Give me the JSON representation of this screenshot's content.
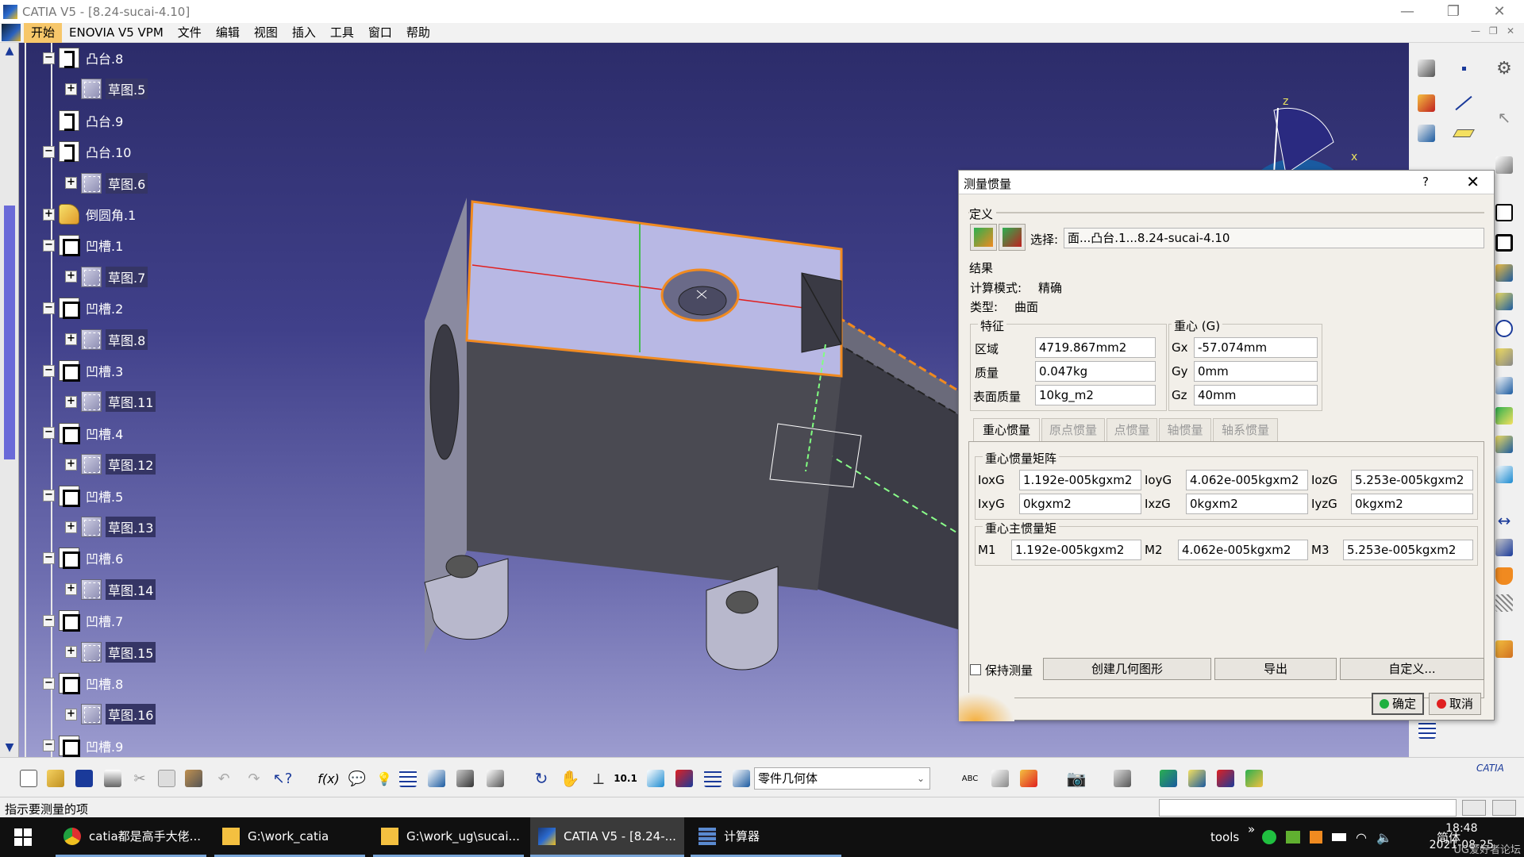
{
  "window": {
    "title": "CATIA V5 - [8.24-sucai-4.10]",
    "min": "—",
    "restore": "❐",
    "close": "✕"
  },
  "menu": {
    "items": [
      "开始",
      "ENOVIA V5 VPM",
      "文件",
      "编辑",
      "视图",
      "插入",
      "工具",
      "窗口",
      "帮助"
    ],
    "doc_controls": [
      "—",
      "❐",
      "✕"
    ]
  },
  "tree": {
    "nodes": [
      {
        "label": "凸台.8",
        "type": "pad",
        "toggle": "−"
      },
      {
        "label": "草图.5",
        "type": "sketch",
        "toggle": "+"
      },
      {
        "label": "凸台.9",
        "type": "pad",
        "toggle": ""
      },
      {
        "label": "凸台.10",
        "type": "pad",
        "toggle": "−"
      },
      {
        "label": "草图.6",
        "type": "sketch",
        "toggle": "+"
      },
      {
        "label": "倒圆角.1",
        "type": "fillet",
        "toggle": "+"
      },
      {
        "label": "凹槽.1",
        "type": "pocket",
        "toggle": "−"
      },
      {
        "label": "草图.7",
        "type": "sketch",
        "toggle": "+"
      },
      {
        "label": "凹槽.2",
        "type": "pocket",
        "toggle": "−"
      },
      {
        "label": "草图.8",
        "type": "sketch",
        "toggle": "+"
      },
      {
        "label": "凹槽.3",
        "type": "pocket",
        "toggle": "−"
      },
      {
        "label": "草图.11",
        "type": "sketch",
        "toggle": "+"
      },
      {
        "label": "凹槽.4",
        "type": "pocket",
        "toggle": "−"
      },
      {
        "label": "草图.12",
        "type": "sketch",
        "toggle": "+"
      },
      {
        "label": "凹槽.5",
        "type": "pocket",
        "toggle": "−"
      },
      {
        "label": "草图.13",
        "type": "sketch",
        "toggle": "+"
      },
      {
        "label": "凹槽.6",
        "type": "pocket",
        "toggle": "−"
      },
      {
        "label": "草图.14",
        "type": "sketch",
        "toggle": "+"
      },
      {
        "label": "凹槽.7",
        "type": "pocket",
        "toggle": "−"
      },
      {
        "label": "草图.15",
        "type": "sketch",
        "toggle": "+"
      },
      {
        "label": "凹槽.8",
        "type": "pocket",
        "toggle": "−"
      },
      {
        "label": "草图.16",
        "type": "sketch",
        "toggle": "+"
      },
      {
        "label": "凹槽.9",
        "type": "pocket",
        "toggle": "−"
      }
    ]
  },
  "compass": {
    "z": "z",
    "x": "x"
  },
  "dialog": {
    "title": "测量惯量",
    "help": "?",
    "close": "✕",
    "definition_label": "定义",
    "select_label": "选择:",
    "select_value": "面...凸台.1...8.24-sucai-4.10",
    "result_label": "结果",
    "calc_mode_label": "计算模式:",
    "calc_mode_value": "精确",
    "type_label": "类型:",
    "type_value": "曲面",
    "features_label": "特征",
    "area_label": "区域",
    "area_value": "4719.867mm2",
    "mass_label": "质量",
    "mass_value": "0.047kg",
    "surface_mass_label": "表面质量",
    "surface_mass_value": "10kg_m2",
    "cog_label": "重心 (G)",
    "gx_label": "Gx",
    "gx_value": "-57.074mm",
    "gy_label": "Gy",
    "gy_value": "0mm",
    "gz_label": "Gz",
    "gz_value": "40mm",
    "tabs": [
      "重心惯量",
      "原点惯量",
      "点惯量",
      "轴惯量",
      "轴系惯量"
    ],
    "matrix_label": "重心惯量矩阵",
    "ioxg_label": "IoxG",
    "ioxg_value": "1.192e-005kgxm2",
    "ioyg_label": "IoyG",
    "ioyg_value": "4.062e-005kgxm2",
    "iozg_label": "IozG",
    "iozg_value": "5.253e-005kgxm2",
    "ixyg_label": "IxyG",
    "ixyg_value": "0kgxm2",
    "ixzg_label": "IxzG",
    "ixzg_value": "0kgxm2",
    "iyzg_label": "IyzG",
    "iyzg_value": "0kgxm2",
    "principal_label": "重心主惯量矩",
    "m1_label": "M1",
    "m1_value": "1.192e-005kgxm2",
    "m2_label": "M2",
    "m2_value": "4.062e-005kgxm2",
    "m3_label": "M3",
    "m3_value": "5.253e-005kgxm2",
    "keep_label": "保持测量",
    "create_geom": "创建几何图形",
    "export": "导出",
    "customize": "自定义...",
    "ok": "确定",
    "cancel": "取消"
  },
  "toolbar": {
    "body_combo": "零件几何体",
    "combo_arrow": "⌄",
    "catia_brand": "CATIA"
  },
  "status": {
    "text": "指示要测量的项"
  },
  "taskbar": {
    "tasks": [
      "catia都是高手大佬...",
      "G:\\work_catia",
      "G:\\work_ug\\sucai...",
      "CATIA V5 - [8.24-...",
      "计算器"
    ],
    "tools_label": "tools",
    "chevron": "»",
    "ime": "简体",
    "time": "18:48",
    "date": "2021-08-25",
    "watermark": "UG爱好者论坛"
  },
  "colors": {
    "accent": "#f7c76a",
    "highlight": "#f08a20",
    "viewport_top": "#2c2c6a",
    "viewport_bottom": "#9c9ccf"
  }
}
